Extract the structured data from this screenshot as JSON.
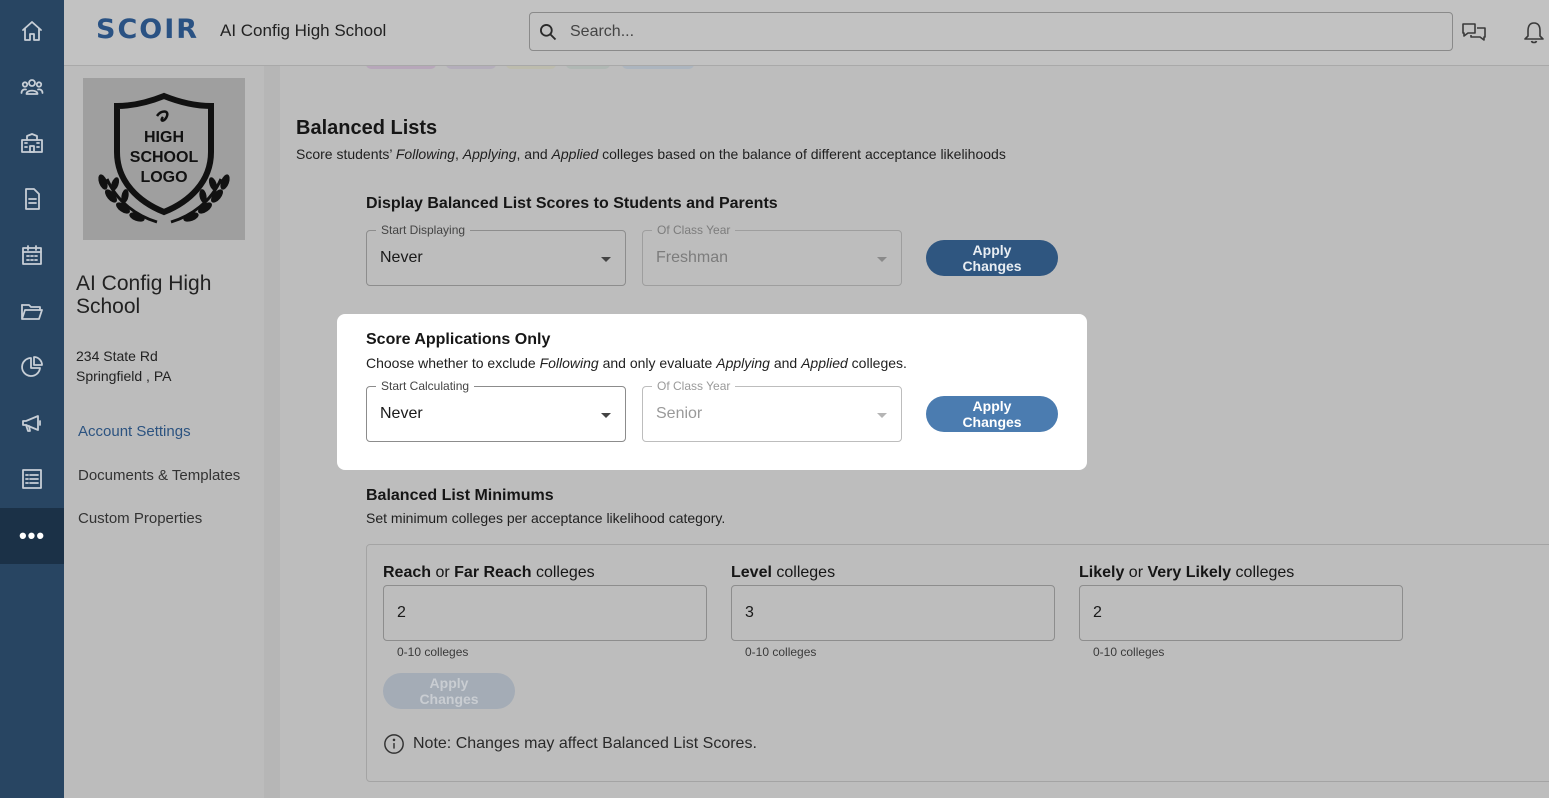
{
  "header": {
    "brand": "SCOIR",
    "school_name": "AI Config High School",
    "search_placeholder": "Search..."
  },
  "rail": {
    "items": [
      "home-icon",
      "students-icon",
      "school-icon",
      "document-icon",
      "calendar-icon",
      "folder-icon",
      "analytics-icon",
      "megaphone-icon",
      "checklist-icon",
      "more-icon"
    ],
    "more_label": "•••"
  },
  "sidebar": {
    "logo": {
      "line1": "HIGH",
      "line2": "SCHOOL",
      "line3": "LOGO"
    },
    "title": "AI Config High School",
    "address_line1": "234 State Rd",
    "address_line2": "Springfield , PA",
    "nav": [
      {
        "label": "Account Settings",
        "active": true
      },
      {
        "label": "Documents & Templates",
        "active": false
      },
      {
        "label": "Custom Properties",
        "active": false
      }
    ]
  },
  "balanced_lists": {
    "title": "Balanced Lists",
    "desc_parts": [
      "Score students’ ",
      "Following",
      ", ",
      "Applying",
      ", and ",
      "Applied",
      " colleges based on the balance of different acceptance likelihoods"
    ]
  },
  "display_scores": {
    "title": "Display Balanced List Scores to Students and Parents",
    "start_label": "Start Displaying",
    "start_value": "Never",
    "year_label": "Of Class Year",
    "year_value": "Freshman",
    "button": "Apply Changes"
  },
  "score_applications": {
    "title": "Score Applications Only",
    "desc_parts": [
      "Choose whether to exclude ",
      "Following",
      " and only evaluate ",
      "Applying",
      " and ",
      "Applied",
      " colleges."
    ],
    "start_label": "Start Calculating",
    "start_value": "Never",
    "year_label": "Of Class Year",
    "year_value": "Senior",
    "button": "Apply Changes"
  },
  "minimums": {
    "title": "Balanced List Minimums",
    "desc": "Set minimum colleges per acceptance likelihood category.",
    "fields": [
      {
        "label_bold": "Reach",
        "label_mid": " or ",
        "label_bold2": "Far Reach",
        "label_tail": " colleges",
        "value": "2",
        "helper": "0-10 colleges"
      },
      {
        "label_bold": "Level",
        "label_mid": "",
        "label_bold2": "",
        "label_tail": " colleges",
        "value": "3",
        "helper": "0-10 colleges"
      },
      {
        "label_bold": "Likely",
        "label_mid": " or ",
        "label_bold2": "Very Likely",
        "label_tail": " colleges",
        "value": "2",
        "helper": "0-10 colleges"
      }
    ],
    "button": "Apply Changes",
    "note": "Note: Changes may affect Balanced List Scores."
  }
}
